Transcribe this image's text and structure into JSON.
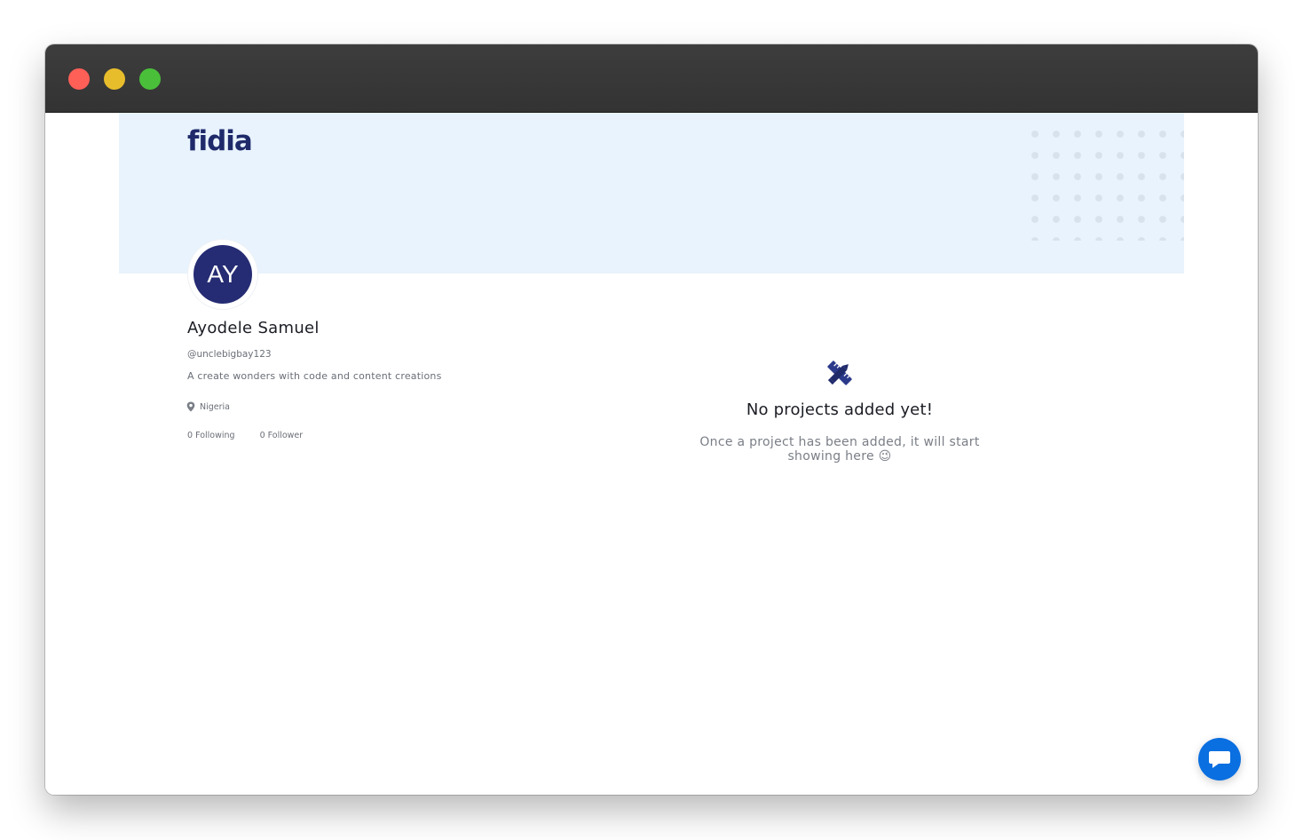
{
  "window": {
    "controls": [
      {
        "name": "close",
        "color": "#fe5f57"
      },
      {
        "name": "minimize",
        "color": "#e8bd2c"
      },
      {
        "name": "maximize",
        "color": "#4ac03a"
      }
    ]
  },
  "brand": {
    "logo_text": "fidia",
    "primary_color": "#1f2a6b",
    "accent_color": "#f2b705",
    "banner_color": "#e8f3fd"
  },
  "profile": {
    "initials": "AY",
    "name": "Ayodele Samuel",
    "handle": "@unclebigbay123",
    "bio": "A create wonders with code and content creations",
    "location": "Nigeria",
    "location_icon": "map-pin-icon",
    "following_label": "0 Following",
    "follower_label": "0 Follower"
  },
  "projects": {
    "empty_icon": "pencil-ruler-icon",
    "empty_title": "No projects added yet!",
    "empty_description": "Once a project has been added, it will start showing here 😉"
  },
  "chat": {
    "icon": "chat-bubble-icon",
    "color": "#0a6fe0"
  }
}
